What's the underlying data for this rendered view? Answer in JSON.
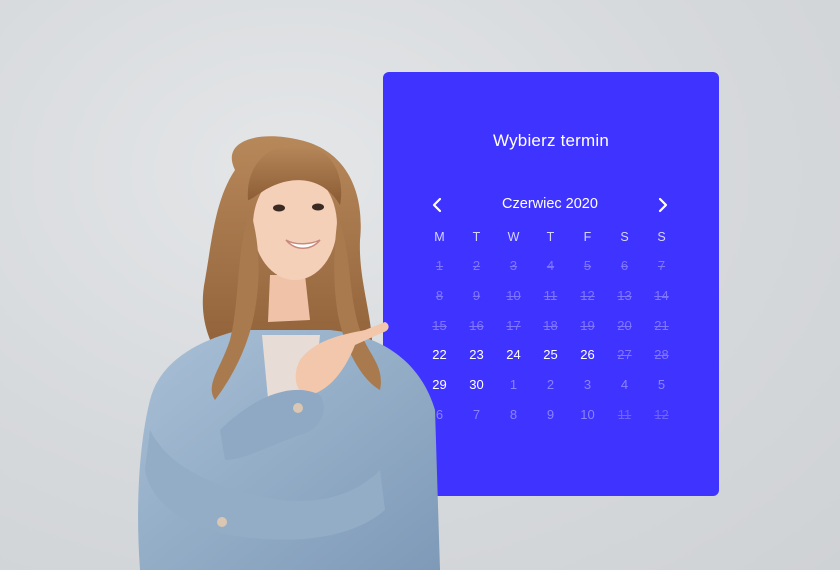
{
  "calendar": {
    "title": "Wybierz termin",
    "month_label": "Czerwiec 2020",
    "prev_icon": "chevron-left-icon",
    "next_icon": "chevron-right-icon",
    "weekdays": [
      "M",
      "T",
      "W",
      "T",
      "F",
      "S",
      "S"
    ],
    "weeks": [
      [
        {
          "d": "1",
          "state": "disabled"
        },
        {
          "d": "2",
          "state": "disabled"
        },
        {
          "d": "3",
          "state": "disabled"
        },
        {
          "d": "4",
          "state": "disabled"
        },
        {
          "d": "5",
          "state": "disabled"
        },
        {
          "d": "6",
          "state": "disabled"
        },
        {
          "d": "7",
          "state": "disabled"
        }
      ],
      [
        {
          "d": "8",
          "state": "disabled"
        },
        {
          "d": "9",
          "state": "disabled"
        },
        {
          "d": "10",
          "state": "disabled"
        },
        {
          "d": "11",
          "state": "disabled"
        },
        {
          "d": "12",
          "state": "disabled"
        },
        {
          "d": "13",
          "state": "disabled"
        },
        {
          "d": "14",
          "state": "disabled"
        }
      ],
      [
        {
          "d": "15",
          "state": "disabled"
        },
        {
          "d": "16",
          "state": "disabled"
        },
        {
          "d": "17",
          "state": "disabled"
        },
        {
          "d": "18",
          "state": "disabled"
        },
        {
          "d": "19",
          "state": "disabled"
        },
        {
          "d": "20",
          "state": "disabled"
        },
        {
          "d": "21",
          "state": "disabled"
        }
      ],
      [
        {
          "d": "22",
          "state": "available"
        },
        {
          "d": "23",
          "state": "available"
        },
        {
          "d": "24",
          "state": "available"
        },
        {
          "d": "25",
          "state": "available"
        },
        {
          "d": "26",
          "state": "available"
        },
        {
          "d": "27",
          "state": "disabled"
        },
        {
          "d": "28",
          "state": "disabled"
        }
      ],
      [
        {
          "d": "29",
          "state": "available"
        },
        {
          "d": "30",
          "state": "available"
        },
        {
          "d": "1",
          "state": "other"
        },
        {
          "d": "2",
          "state": "other"
        },
        {
          "d": "3",
          "state": "other"
        },
        {
          "d": "4",
          "state": "other"
        },
        {
          "d": "5",
          "state": "other"
        }
      ],
      [
        {
          "d": "6",
          "state": "other"
        },
        {
          "d": "7",
          "state": "other"
        },
        {
          "d": "8",
          "state": "other"
        },
        {
          "d": "9",
          "state": "other"
        },
        {
          "d": "10",
          "state": "other"
        },
        {
          "d": "11",
          "state": "other-disabled"
        },
        {
          "d": "12",
          "state": "other-disabled"
        }
      ]
    ]
  },
  "colors": {
    "card_bg": "#3f33ff",
    "background": "#d6d9dc",
    "text_primary": "#ffffff",
    "text_disabled": "#7f75ff"
  }
}
